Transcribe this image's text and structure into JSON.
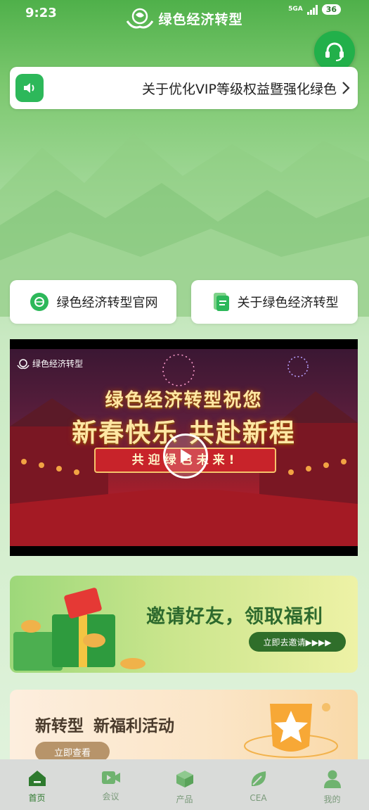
{
  "status_bar": {
    "time": "9:23",
    "network": "5GA",
    "battery": "36"
  },
  "header": {
    "brand_name": "绿色经济转型"
  },
  "notice": {
    "text": "关于优化VIP等级权益暨强化绿色"
  },
  "quick_links": [
    {
      "label": "绿色经济转型官网",
      "icon": "leaf-globe-icon"
    },
    {
      "label": "关于绿色经济转型",
      "icon": "document-icon"
    }
  ],
  "video": {
    "brand": "绿色经济转型",
    "title_line1": "绿色经济转型祝您",
    "title_line2": "新春快乐 共赴新程",
    "ribbon": "共迎绿色未来!"
  },
  "invite_banner": {
    "title": "邀请好友，领取福利",
    "button": "立即去邀请▶▶▶▶"
  },
  "promo_banner": {
    "title_part1": "新转型",
    "title_part2": "新福利活动",
    "button": "立即查看"
  },
  "tab_bar": [
    {
      "label": "首页",
      "icon": "home-icon",
      "active": true
    },
    {
      "label": "会议",
      "icon": "video-camera-icon",
      "active": false
    },
    {
      "label": "产品",
      "icon": "cube-icon",
      "active": false
    },
    {
      "label": "CEA",
      "icon": "leaf-icon",
      "active": false
    },
    {
      "label": "我的",
      "icon": "person-icon",
      "active": false
    }
  ],
  "colors": {
    "brand_green": "#2e7a2e",
    "accent_green": "#22b04a"
  }
}
